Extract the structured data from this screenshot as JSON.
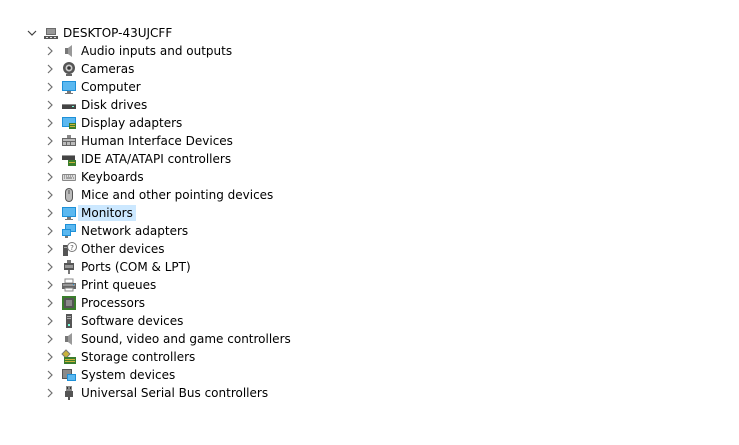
{
  "colors": {
    "selection": "#cce8ff",
    "arrow": "#707070",
    "monitor_blue": "#1e90d8"
  },
  "tree": {
    "root": {
      "label": "DESKTOP-43UJCFF",
      "icon": "computer-tower-icon",
      "expanded": true
    },
    "children": [
      {
        "label": "Audio inputs and outputs",
        "icon": "speaker-icon"
      },
      {
        "label": "Cameras",
        "icon": "webcam-icon"
      },
      {
        "label": "Computer",
        "icon": "monitor-icon"
      },
      {
        "label": "Disk drives",
        "icon": "disk-drive-icon"
      },
      {
        "label": "Display adapters",
        "icon": "display-adapter-icon"
      },
      {
        "label": "Human Interface Devices",
        "icon": "hid-icon"
      },
      {
        "label": "IDE ATA/ATAPI controllers",
        "icon": "ide-controller-icon"
      },
      {
        "label": "Keyboards",
        "icon": "keyboard-icon"
      },
      {
        "label": "Mice and other pointing devices",
        "icon": "mouse-icon"
      },
      {
        "label": "Monitors",
        "icon": "monitor-icon",
        "selected": true
      },
      {
        "label": "Network adapters",
        "icon": "network-adapter-icon"
      },
      {
        "label": "Other devices",
        "icon": "unknown-device-icon"
      },
      {
        "label": "Ports (COM & LPT)",
        "icon": "port-icon"
      },
      {
        "label": "Print queues",
        "icon": "printer-icon"
      },
      {
        "label": "Processors",
        "icon": "processor-icon"
      },
      {
        "label": "Software devices",
        "icon": "software-device-icon"
      },
      {
        "label": "Sound, video and game controllers",
        "icon": "sound-icon"
      },
      {
        "label": "Storage controllers",
        "icon": "storage-controller-icon"
      },
      {
        "label": "System devices",
        "icon": "system-device-icon"
      },
      {
        "label": "Universal Serial Bus controllers",
        "icon": "usb-icon"
      }
    ]
  }
}
